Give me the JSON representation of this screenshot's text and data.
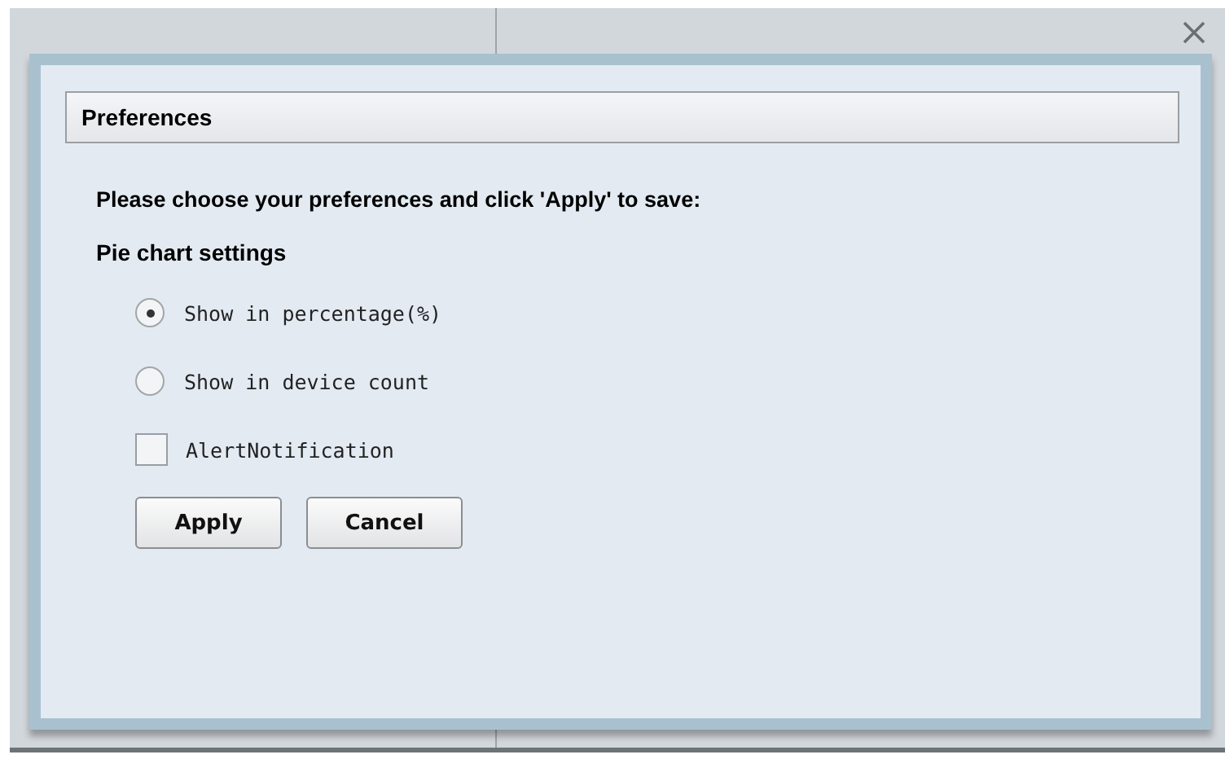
{
  "dialog": {
    "title": "Preferences",
    "instruction": "Please choose your preferences and click 'Apply' to save:",
    "section": "Pie chart settings",
    "options": [
      {
        "kind": "radio",
        "label": "Show in percentage(%)",
        "selected": true
      },
      {
        "kind": "radio",
        "label": "Show in device count",
        "selected": false
      },
      {
        "kind": "checkbox",
        "label": "AlertNotification",
        "checked": false
      }
    ],
    "buttons": [
      "Apply",
      "Cancel"
    ]
  }
}
